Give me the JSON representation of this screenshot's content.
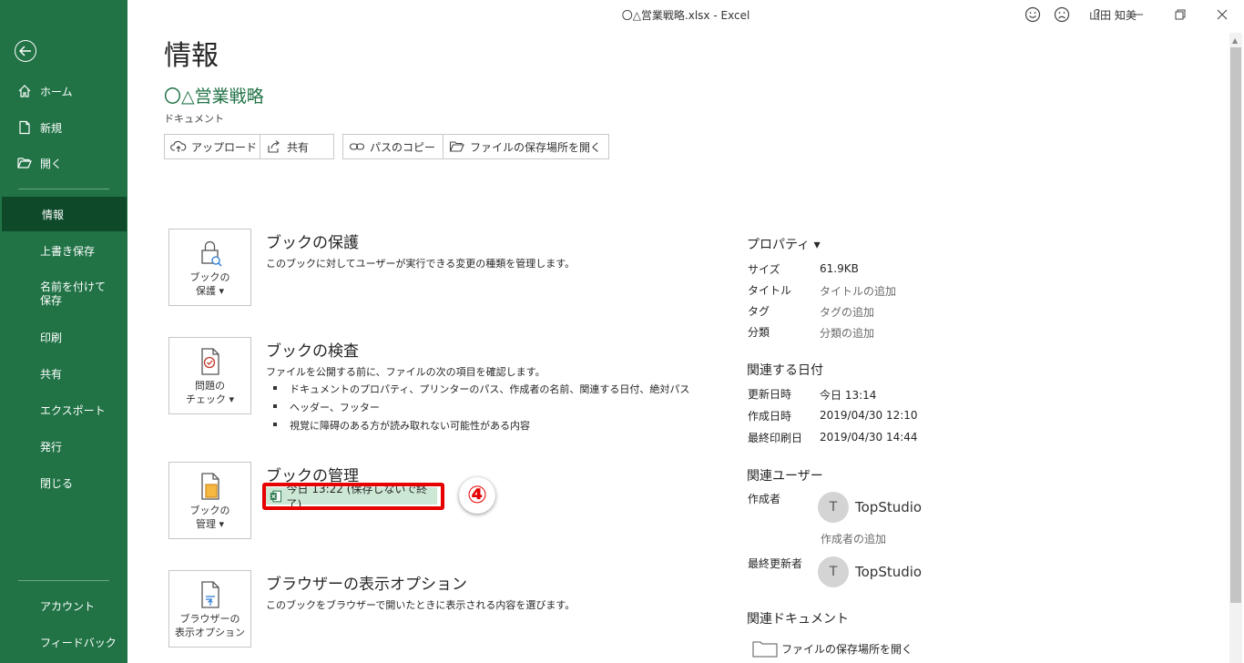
{
  "window": {
    "title": "〇△営業戦略.xlsx  -  Excel",
    "user": "山田 知美",
    "help": "?"
  },
  "sidebar": {
    "top_items": [
      {
        "label": "ホーム",
        "icon": "home-icon"
      },
      {
        "label": "新規",
        "icon": "new-document-icon"
      },
      {
        "label": "開く",
        "icon": "open-folder-icon"
      }
    ],
    "items": [
      {
        "label": "情報",
        "active": true
      },
      {
        "label": "上書き保存"
      },
      {
        "label": "名前を付けて保存"
      },
      {
        "label": "印刷"
      },
      {
        "label": "共有"
      },
      {
        "label": "エクスポート"
      },
      {
        "label": "発行"
      },
      {
        "label": "閉じる"
      }
    ],
    "bottom_items": [
      {
        "label": "アカウント"
      },
      {
        "label": "フィードバック"
      }
    ]
  },
  "main": {
    "title": "情報",
    "doc_name": "〇△営業戦略",
    "doc_location": "ドキュメント",
    "actions": [
      {
        "label": "アップロード",
        "icon": "cloud-upload-icon"
      },
      {
        "label": "共有",
        "icon": "share-icon"
      },
      {
        "label": "パスのコピー",
        "icon": "link-icon"
      },
      {
        "label": "ファイルの保存場所を開く",
        "icon": "folder-icon"
      }
    ],
    "sections": {
      "protect": {
        "tile_line1": "ブックの",
        "tile_line2": "保護 ▾",
        "title": "ブックの保護",
        "desc": "このブックに対してユーザーが実行できる変更の種類を管理します。"
      },
      "inspect": {
        "tile_line1": "問題の",
        "tile_line2": "チェック ▾",
        "title": "ブックの検査",
        "desc": "ファイルを公開する前に、ファイルの次の項目を確認します。",
        "bullets": [
          "ドキュメントのプロパティ、プリンターのパス、作成者の名前、関連する日付、絶対パス",
          "ヘッダー、フッター",
          "視覚に障碍のある方が読み取れない可能性がある内容"
        ]
      },
      "manage": {
        "tile_line1": "ブックの",
        "tile_line2": "管理 ▾",
        "title": "ブックの管理",
        "version": "今日 13:22 (保存しないで終了)",
        "step": "④"
      },
      "browser": {
        "tile_line1": "ブラウザーの",
        "tile_line2": "表示オプション",
        "title": "ブラウザーの表示オプション",
        "desc": "このブックをブラウザーで開いたときに表示される内容を選びます。"
      }
    }
  },
  "properties": {
    "heading": "プロパティ ▾",
    "rows": [
      {
        "key": "サイズ",
        "value": "61.9KB"
      },
      {
        "key": "タイトル",
        "value": "タイトルの追加"
      },
      {
        "key": "タグ",
        "value": "タグの追加"
      },
      {
        "key": "分類",
        "value": "分類の追加"
      }
    ],
    "dates_heading": "関連する日付",
    "dates": [
      {
        "key": "更新日時",
        "value": "今日 13:14"
      },
      {
        "key": "作成日時",
        "value": "2019/04/30 12:10"
      },
      {
        "key": "最終印刷日",
        "value": "2019/04/30 14:44"
      }
    ],
    "people_heading": "関連ユーザー",
    "author_label": "作成者",
    "author_initial": "T",
    "author_name": "TopStudio",
    "add_author": "作成者の追加",
    "modified_label": "最終更新者",
    "modified_initial": "T",
    "modified_name": "TopStudio",
    "docs_heading": "関連ドキュメント",
    "open_location": "ファイルの保存場所を開く"
  },
  "colors": {
    "sidebar": "#217346",
    "sidebar_active": "#0e4a2a",
    "highlight": "#e60000",
    "version_bg": "#cce8d5"
  }
}
